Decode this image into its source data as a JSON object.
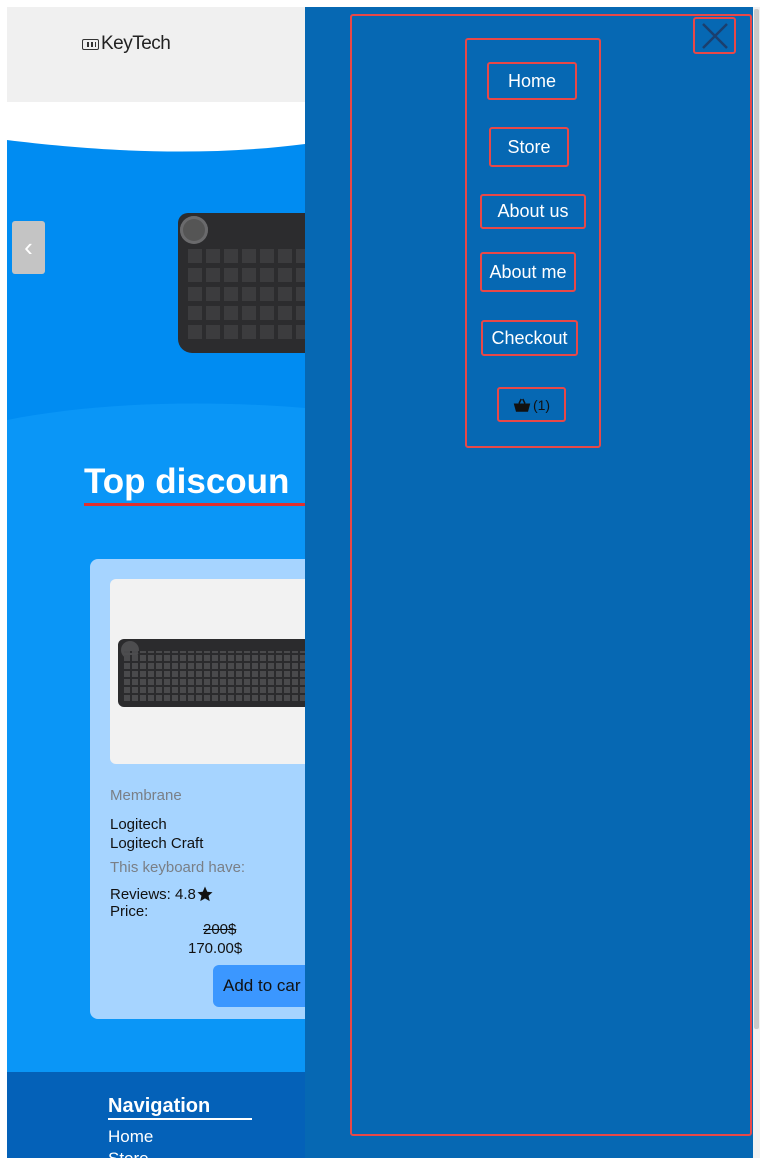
{
  "header": {
    "logo_text": "KeyTech",
    "logo_icon": "keyboard-icon"
  },
  "hero": {
    "prev_icon": "chevron-left-icon",
    "prev_glyph": "‹"
  },
  "section": {
    "title": "Top discoun"
  },
  "product": {
    "category": "Membrane",
    "brand": "Logitech",
    "name": "Logitech Craft",
    "feature_label": "This keyboard have:",
    "reviews_label": "Reviews: 4.8",
    "price_label": "Price:",
    "old_price": "200$",
    "new_price": "170.00$",
    "add_button": "Add to car"
  },
  "footer": {
    "title": "Navigation",
    "links": [
      "Home",
      "Store"
    ]
  },
  "drawer": {
    "close_icon": "close-icon",
    "items": [
      "Home",
      "Store",
      "About us",
      "About me",
      "Checkout"
    ],
    "cart": {
      "icon": "basket-icon",
      "count_label": "(1)"
    }
  },
  "colors": {
    "hero_blue": "#008cf2",
    "drawer_blue": "#0668b3",
    "card_blue": "#a6d4ff",
    "highlight_red": "#e84848"
  }
}
